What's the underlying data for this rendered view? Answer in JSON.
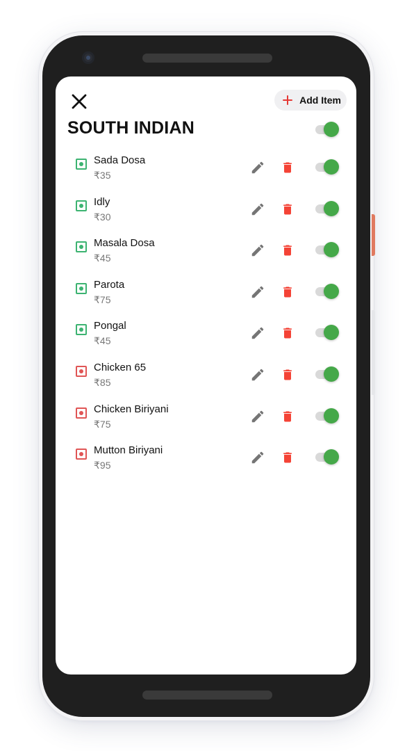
{
  "header": {
    "add_item_label": "Add Item",
    "category_title": "SOUTH INDIAN",
    "category_enabled": true
  },
  "colors": {
    "veg": "#3cb371",
    "nonveg": "#e05555",
    "toggle_on": "#45a849",
    "delete": "#f44336",
    "edit": "#757575",
    "accent_plus": "#e53935"
  },
  "items": [
    {
      "name": "Sada Dosa",
      "price": "₹35",
      "type": "veg",
      "enabled": true
    },
    {
      "name": "Idly",
      "price": "₹30",
      "type": "veg",
      "enabled": true
    },
    {
      "name": "Masala Dosa",
      "price": "₹45",
      "type": "veg",
      "enabled": true
    },
    {
      "name": "Parota",
      "price": "₹75",
      "type": "veg",
      "enabled": true
    },
    {
      "name": "Pongal",
      "price": "₹45",
      "type": "veg",
      "enabled": true
    },
    {
      "name": "Chicken 65",
      "price": "₹85",
      "type": "nonveg",
      "enabled": true
    },
    {
      "name": "Chicken Biriyani",
      "price": "₹75",
      "type": "nonveg",
      "enabled": true
    },
    {
      "name": "Mutton Biriyani",
      "price": "₹95",
      "type": "nonveg",
      "enabled": true
    }
  ]
}
